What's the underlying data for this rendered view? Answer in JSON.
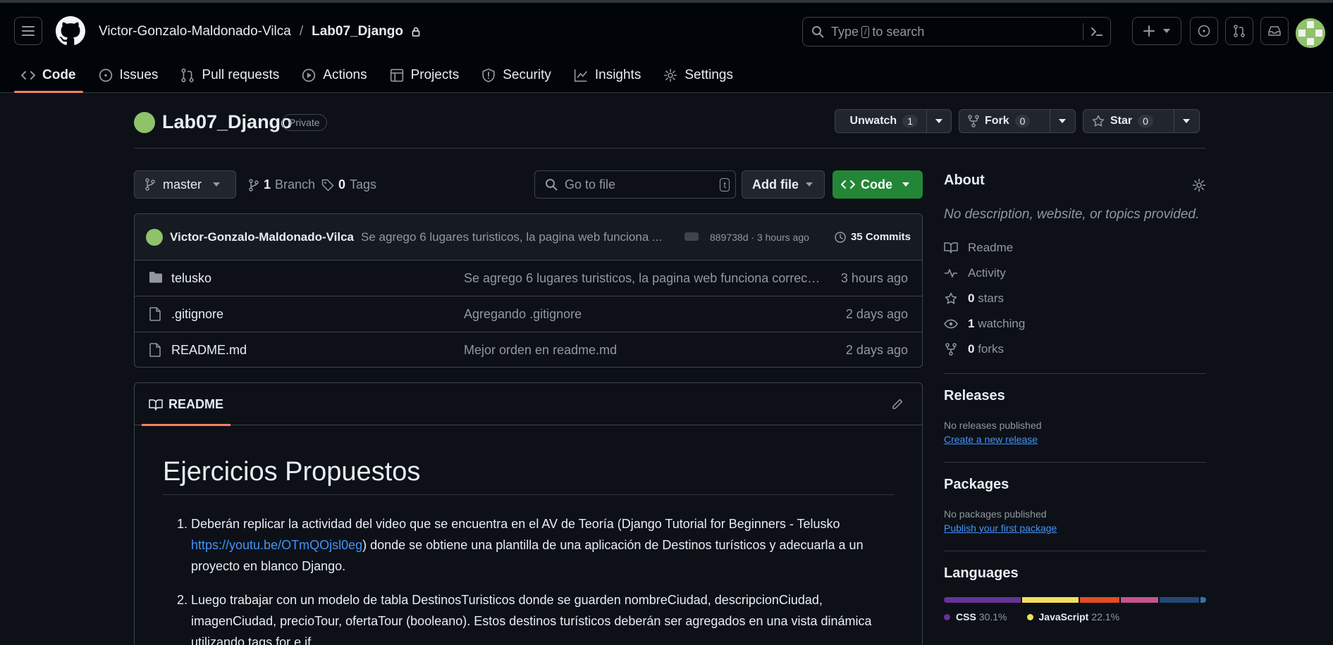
{
  "breadcrumb": {
    "owner": "Victor-Gonzalo-Maldonado-Vilca",
    "separator": "/",
    "repo": "Lab07_Django"
  },
  "search": {
    "prefix": "Type",
    "key": "/",
    "suffix": "to search"
  },
  "nav_tabs": [
    {
      "label": "Code",
      "icon": "code-icon",
      "active": true
    },
    {
      "label": "Issues",
      "icon": "issue-icon"
    },
    {
      "label": "Pull requests",
      "icon": "pull-request-icon"
    },
    {
      "label": "Actions",
      "icon": "play-icon"
    },
    {
      "label": "Projects",
      "icon": "table-icon"
    },
    {
      "label": "Security",
      "icon": "shield-icon"
    },
    {
      "label": "Insights",
      "icon": "graph-icon"
    },
    {
      "label": "Settings",
      "icon": "gear-icon"
    }
  ],
  "repo": {
    "name": "Lab07_Django",
    "visibility": "Private",
    "unwatch_label": "Unwatch",
    "watch_count": "1",
    "fork_label": "Fork",
    "fork_count": "0",
    "star_label": "Star",
    "star_count": "0"
  },
  "filenav": {
    "branch": "master",
    "branch_count": "1",
    "branch_label": "Branch",
    "tag_count": "0",
    "tag_label": "Tags",
    "goto_placeholder": "Go to file",
    "goto_key": "t",
    "add_file": "Add file",
    "code_button": "Code"
  },
  "latest_commit": {
    "author": "Victor-Gonzalo-Maldonado-Vilca",
    "message": "Se agrego 6 lugares turisticos, la pagina web funciona ...",
    "meta": "889738d · 3 hours ago",
    "commits_label": "35 Commits"
  },
  "files": [
    {
      "name": "telusko",
      "type": "folder",
      "message": "Se agrego 6 lugares turisticos, la pagina web funciona correc…",
      "time": "3 hours ago"
    },
    {
      "name": ".gitignore",
      "type": "file",
      "message": "Agregando .gitignore",
      "time": "2 days ago"
    },
    {
      "name": "README.md",
      "type": "file",
      "message": "Mejor orden en readme.md",
      "time": "2 days ago"
    }
  ],
  "readme": {
    "tab_label": "README",
    "heading": "Ejercicios Propuestos",
    "item1_a": "Deberán replicar la actividad del video que se encuentra en el AV de Teoría (Django Tutorial for Beginners - Telusko ",
    "item1_link": "https://youtu.be/OTmQOjsl0eg",
    "item1_b": ") donde se obtiene una plantilla de una aplicación de Destinos turísticos y adecuarla a un proyecto en blanco Django.",
    "item2": "Luego trabajar con un modelo de tabla DestinosTuristicos donde se guarden nombreCiudad, descripcionCiudad, imagenCiudad, precioTour, ofertaTour (booleano). Estos destinos turísticos deberán ser agregados en una vista dinámica utilizando tags for e if."
  },
  "about": {
    "title": "About",
    "description": "No description, website, or topics provided.",
    "readme": "Readme",
    "activity": "Activity",
    "stars_count": "0",
    "stars_label": "stars",
    "watching_count": "1",
    "watching_label": "watching",
    "forks_count": "0",
    "forks_label": "forks"
  },
  "releases": {
    "title": "Releases",
    "status": "No releases published",
    "link": "Create a new release"
  },
  "packages": {
    "title": "Packages",
    "status": "No packages published",
    "link": "Publish your first package"
  },
  "languages": {
    "title": "Languages",
    "items": [
      {
        "name": "CSS",
        "percent": "30.1%",
        "value": 30.1,
        "color": "#663399"
      },
      {
        "name": "JavaScript",
        "percent": "22.1%",
        "value": 22.1,
        "color": "#f1e05a"
      },
      {
        "name": "",
        "percent": "",
        "value": 15.5,
        "color": "#e34c26"
      },
      {
        "name": "",
        "percent": "",
        "value": 14.5,
        "color": "#c6538c"
      },
      {
        "name": "",
        "percent": "",
        "value": 15.5,
        "color": "#244776"
      },
      {
        "name": "",
        "percent": "",
        "value": 2.3,
        "color": "#3572a5"
      }
    ]
  },
  "colors": {
    "accent": "#f78166",
    "green": "#238636",
    "link": "#4493f8"
  }
}
